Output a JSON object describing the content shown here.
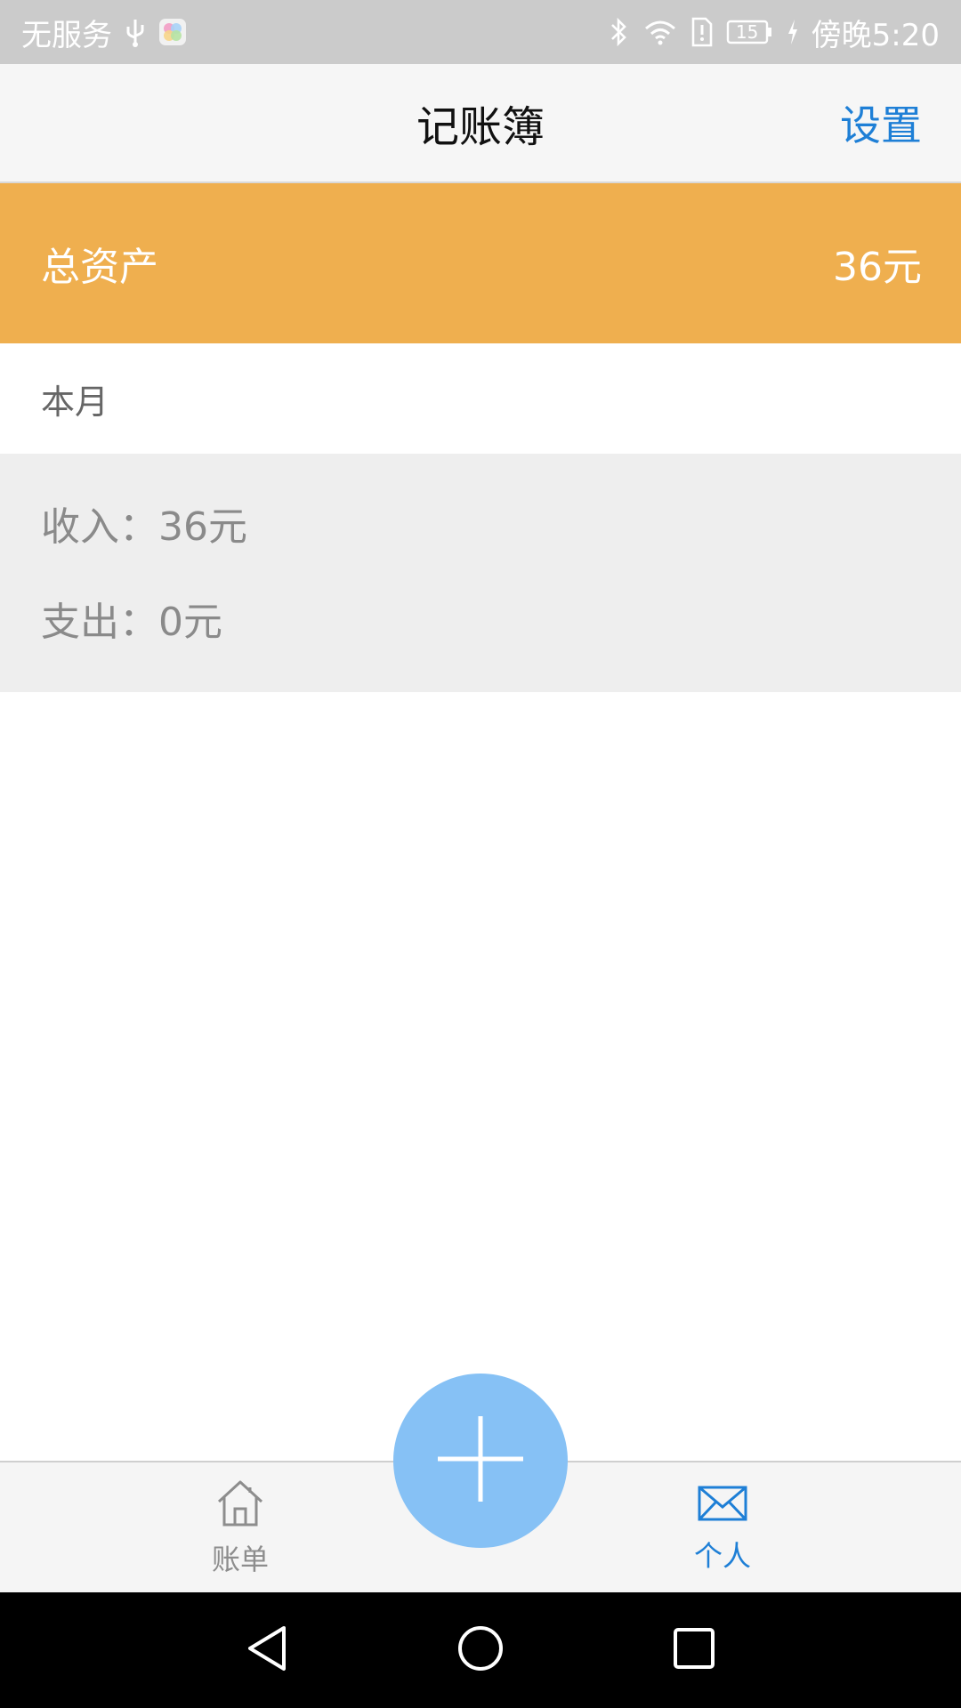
{
  "status_bar": {
    "carrier": "无服务",
    "battery_level": "15",
    "time": "傍晚5:20",
    "icons": [
      "usb-icon",
      "app-notification-icon",
      "bluetooth-icon",
      "wifi-icon",
      "sim-alert-icon",
      "battery-icon",
      "charging-icon"
    ]
  },
  "header": {
    "title": "记账簿",
    "settings_label": "设置"
  },
  "assets": {
    "label": "总资产",
    "value": "36元"
  },
  "month": {
    "label": "本月"
  },
  "stats": {
    "income_label": "收入：",
    "income_value": "36元",
    "expense_label": "支出：",
    "expense_value": "0元"
  },
  "bottom_nav": {
    "items": [
      {
        "label": "账单",
        "icon": "home-icon",
        "active": false
      },
      {
        "label": "个人",
        "icon": "mail-icon",
        "active": true
      }
    ]
  },
  "fab": {
    "icon": "plus-icon"
  },
  "system_nav": {
    "icons": [
      "back-icon",
      "home-circle-icon",
      "recent-apps-icon"
    ]
  },
  "colors": {
    "status_bar_bg": "#cbcbcb",
    "header_bg": "#f6f6f6",
    "accent_blue": "#1e7fd6",
    "assets_bg": "#efaf4f",
    "stats_bg": "#eeeeee",
    "fab_bg": "#86c1f5"
  }
}
